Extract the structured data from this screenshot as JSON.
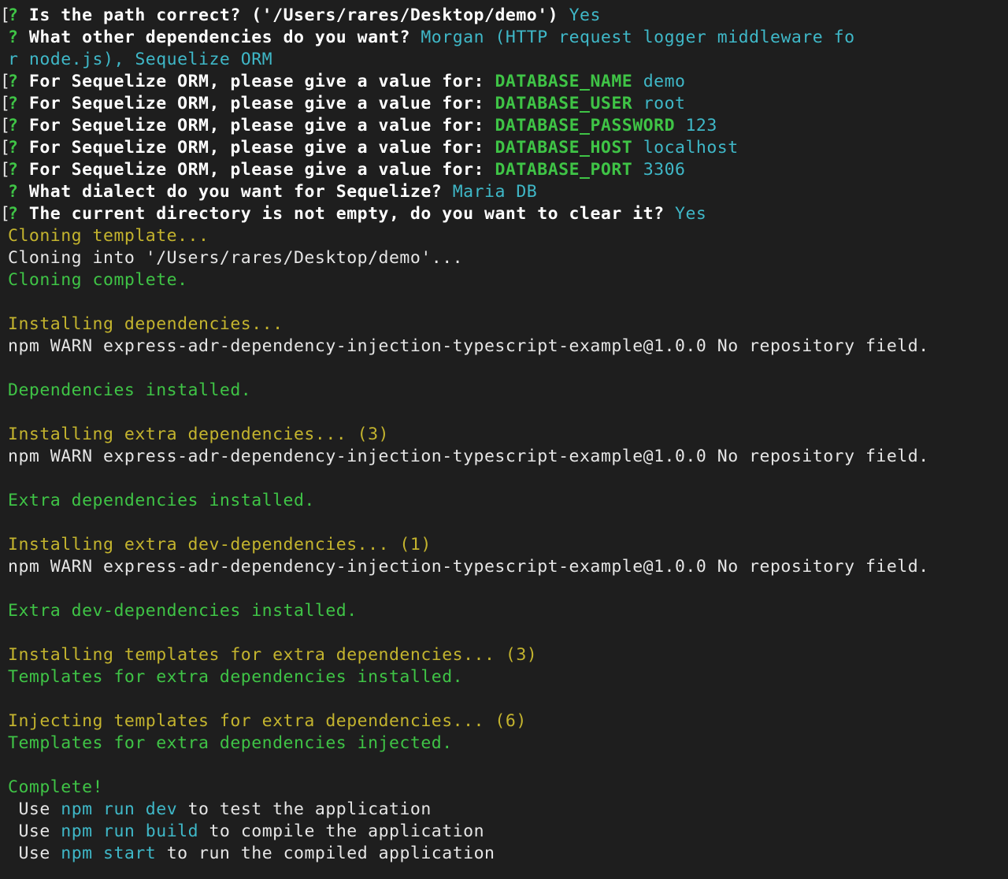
{
  "colors": {
    "background": "#1e1e1e",
    "prompt_green": "#3fc446",
    "answer_cyan": "#3fb8c8",
    "progress_yellow": "#c4b42e",
    "text_white": "#e6e6e6"
  },
  "prompts": {
    "mark": "?",
    "bracket": "[",
    "q_path": "Is the path correct? ('/Users/rares/Desktop/demo')",
    "a_path": "Yes",
    "q_deps": "What other dependencies do you want?",
    "a_deps_1": "Morgan (HTTP request logger middleware fo",
    "a_deps_2": "r node.js), Sequelize ORM",
    "q_orm": "For Sequelize ORM, please give a value for:",
    "k_db_name": "DATABASE_NAME",
    "v_db_name": "demo",
    "k_db_user": "DATABASE_USER",
    "v_db_user": "root",
    "k_db_password": "DATABASE_PASSWORD",
    "v_db_password": "123",
    "k_db_host": "DATABASE_HOST",
    "v_db_host": "localhost",
    "k_db_port": "DATABASE_PORT",
    "v_db_port": "3306",
    "q_dialect": "What dialect do you want for Sequelize?",
    "a_dialect": "Maria DB",
    "q_clear": "The current directory is not empty, do you want to clear it?",
    "a_clear": "Yes"
  },
  "output": {
    "cloning_template": "Cloning template...",
    "cloning_into": "Cloning into '/Users/rares/Desktop/demo'...",
    "cloning_complete": "Cloning complete.",
    "installing_deps": "Installing dependencies...",
    "npm_warn": "npm WARN express-adr-dependency-injection-typescript-example@1.0.0 No repository field.",
    "deps_installed": "Dependencies installed.",
    "installing_extra": "Installing extra dependencies... (3)",
    "extra_installed": "Extra dependencies installed.",
    "installing_extra_dev": "Installing extra dev-dependencies... (1)",
    "extra_dev_installed": "Extra dev-dependencies installed.",
    "installing_templates": "Installing templates for extra dependencies... (3)",
    "templates_installed": "Templates for extra dependencies installed.",
    "injecting_templates": "Injecting templates for extra dependencies... (6)",
    "templates_injected": "Templates for extra dependencies injected.",
    "complete": "Complete!"
  },
  "usage": {
    "use": "Use",
    "cmd_dev": "npm run dev",
    "desc_dev": "to test the application",
    "cmd_build": "npm run build",
    "desc_build": "to compile the application",
    "cmd_start": "npm start",
    "desc_start": "to run the compiled application"
  }
}
